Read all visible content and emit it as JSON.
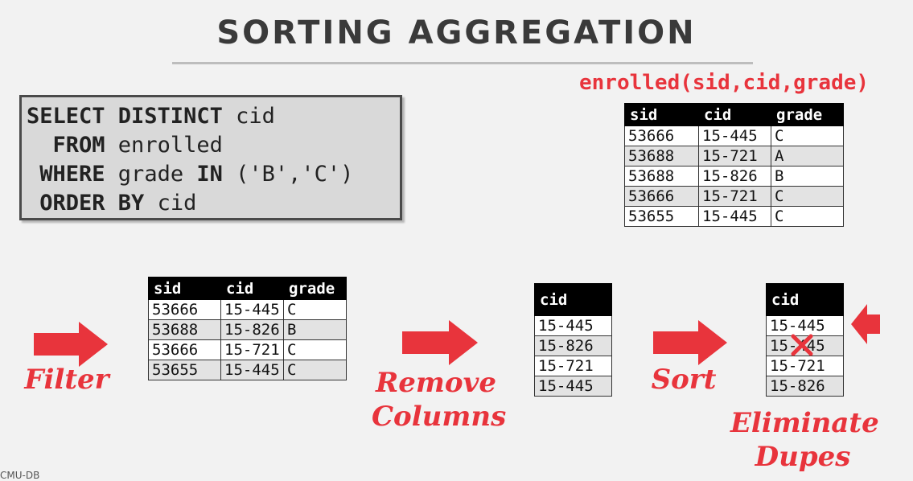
{
  "title": "SORTING AGGREGATION",
  "schema_label": "enrolled(sid,cid,grade)",
  "sql": {
    "lines": [
      {
        "kw1": "SELECT DISTINCT",
        "rest": " cid"
      },
      {
        "kw1": "  FROM",
        "rest": " enrolled"
      },
      {
        "kw1": " WHERE",
        "rest": " grade "
      },
      {
        "kw1": " ORDER BY",
        "rest": " cid"
      }
    ],
    "in_keyword": "IN",
    "in_values": " ('B','C')"
  },
  "source_table": {
    "headers": [
      "sid",
      "cid",
      "grade"
    ],
    "rows": [
      [
        "53666",
        "15-445",
        "C"
      ],
      [
        "53688",
        "15-721",
        "A"
      ],
      [
        "53688",
        "15-826",
        "B"
      ],
      [
        "53666",
        "15-721",
        "C"
      ],
      [
        "53655",
        "15-445",
        "C"
      ]
    ]
  },
  "filtered_table": {
    "headers": [
      "sid",
      "cid",
      "grade"
    ],
    "rows": [
      [
        "53666",
        "15-445",
        "C"
      ],
      [
        "53688",
        "15-826",
        "B"
      ],
      [
        "53666",
        "15-721",
        "C"
      ],
      [
        "53655",
        "15-445",
        "C"
      ]
    ]
  },
  "projected_table": {
    "headers": [
      "cid"
    ],
    "rows": [
      [
        "15-445"
      ],
      [
        "15-826"
      ],
      [
        "15-721"
      ],
      [
        "15-445"
      ]
    ]
  },
  "sorted_table": {
    "headers": [
      "cid"
    ],
    "rows": [
      [
        "15-445"
      ],
      [
        "15-445"
      ],
      [
        "15-721"
      ],
      [
        "15-826"
      ]
    ]
  },
  "steps": {
    "filter": "Filter",
    "remove_columns_1": "Remove",
    "remove_columns_2": "Columns",
    "sort": "Sort",
    "eliminate_1": "Eliminate",
    "eliminate_2": "Dupes"
  },
  "footer": "CMU-DB",
  "colors": {
    "accent": "#e8343c",
    "header_bg": "#000000"
  }
}
